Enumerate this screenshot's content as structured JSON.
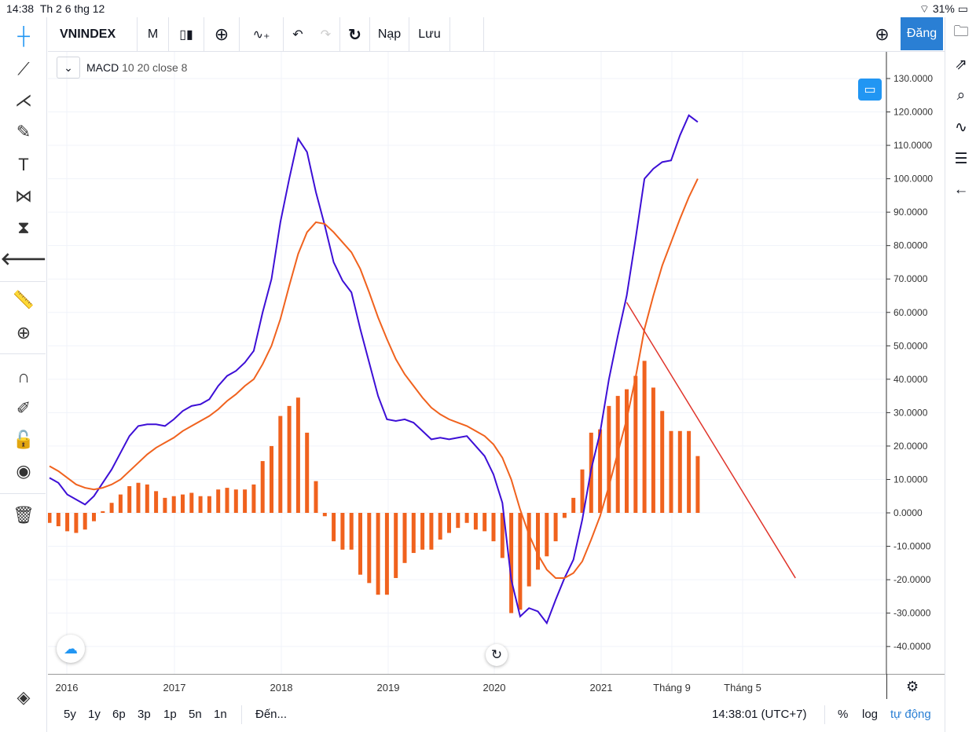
{
  "status_bar": {
    "time": "14:38",
    "date": "Th 2 6 thg 12",
    "battery": "31%"
  },
  "toolbar": {
    "symbol": "VNINDEX",
    "interval": "M",
    "load": "Nạp",
    "save": "Lưu",
    "publish": "Đăng"
  },
  "legend": {
    "indicator": "MACD",
    "params": "10 20 close 8"
  },
  "time_axis": [
    "2016",
    "2017",
    "2018",
    "2019",
    "2020",
    "2021",
    "Tháng 9",
    "Tháng 5"
  ],
  "bottom": {
    "ranges": [
      "5y",
      "1y",
      "6p",
      "3p",
      "1p",
      "5n",
      "1n"
    ],
    "goto": "Đến...",
    "clock": "14:38:01 (UTC+7)",
    "percent": "%",
    "log": "log",
    "auto": "tự động"
  },
  "colors": {
    "macd": "#3d0fd6",
    "signal": "#f0621e",
    "histogram": "#f0621e",
    "trendline": "#e0352b",
    "accent": "#2a7fd4"
  },
  "chart_data": {
    "type": "line",
    "title": "MACD 10 20 close 8",
    "x_start": "2015-11",
    "x_step": "month",
    "ylim": [
      -45,
      135
    ],
    "y_ticks": [
      "130.0000",
      "120.0000",
      "110.0000",
      "100.0000",
      "90.0000",
      "80.0000",
      "70.0000",
      "60.0000",
      "50.0000",
      "40.0000",
      "30.0000",
      "20.0000",
      "10.0000",
      "0.0000",
      "-10.0000",
      "-20.0000",
      "-30.0000",
      "-40.0000"
    ],
    "series": [
      {
        "name": "MACD",
        "type": "line",
        "values": [
          10.5,
          9,
          5.5,
          4,
          2.5,
          5,
          9,
          13,
          18,
          23,
          26,
          26.5,
          26.5,
          26,
          28,
          30.5,
          32,
          32.5,
          34,
          38,
          41,
          42.5,
          45,
          48.5,
          60,
          70,
          87,
          100,
          112,
          108,
          96,
          86,
          75,
          69.5,
          66,
          55,
          45,
          35,
          28,
          27.5,
          28,
          27,
          24.5,
          22,
          22.5,
          22,
          22.5,
          23,
          20,
          17,
          11.5,
          3,
          -20,
          -31,
          -28.5,
          -29.5,
          -33,
          -26,
          -19.5,
          -14,
          -2,
          13,
          24,
          40,
          53,
          65,
          82,
          100,
          103,
          105,
          105.5,
          113,
          119,
          117
        ]
      },
      {
        "name": "Signal",
        "type": "line",
        "values": [
          14,
          12.5,
          10.5,
          8.5,
          7.5,
          7,
          7.5,
          8.5,
          10,
          12.5,
          15,
          17.5,
          19.5,
          21,
          22.5,
          24.5,
          26,
          27.5,
          29,
          31,
          33.5,
          35.5,
          38,
          40,
          44.5,
          50,
          58,
          68,
          77.5,
          84,
          87,
          86.5,
          84,
          81,
          78,
          73,
          66,
          58.5,
          52,
          46,
          41.5,
          38,
          34.5,
          31.5,
          29.5,
          28,
          27,
          26,
          24.5,
          23,
          20.5,
          16.5,
          10,
          1,
          -6.5,
          -12.5,
          -17,
          -19.5,
          -19.5,
          -18,
          -14.5,
          -8,
          -1,
          8,
          18,
          28,
          40.5,
          55,
          65,
          74,
          81,
          88,
          94.5,
          100
        ]
      },
      {
        "name": "Histogram",
        "type": "bar",
        "values": [
          -3,
          -4,
          -5.5,
          -6,
          -5,
          -2.5,
          0.5,
          3,
          5.5,
          8,
          9,
          8.5,
          6.5,
          4.5,
          5,
          5.5,
          6,
          5,
          5,
          7,
          7.5,
          7,
          7,
          8.5,
          15.5,
          20,
          29,
          32,
          34.5,
          24,
          9.5,
          -1,
          -8.5,
          -11,
          -11,
          -18.5,
          -21,
          -24.5,
          -24.5,
          -19.5,
          -15,
          -12,
          -11,
          -11,
          -8,
          -6,
          -4.5,
          -3,
          -5,
          -5.5,
          -8.5,
          -13.5,
          -30,
          -29,
          -22,
          -17,
          -13,
          -8.5,
          -1.5,
          4.5,
          13,
          24,
          25,
          32,
          35,
          37,
          41,
          45.5,
          37.5,
          30.5,
          24.5,
          24.5,
          24.5,
          17
        ]
      }
    ],
    "trendline": {
      "from": [
        65,
        63
      ],
      "to": [
        84,
        -19.5
      ]
    }
  }
}
